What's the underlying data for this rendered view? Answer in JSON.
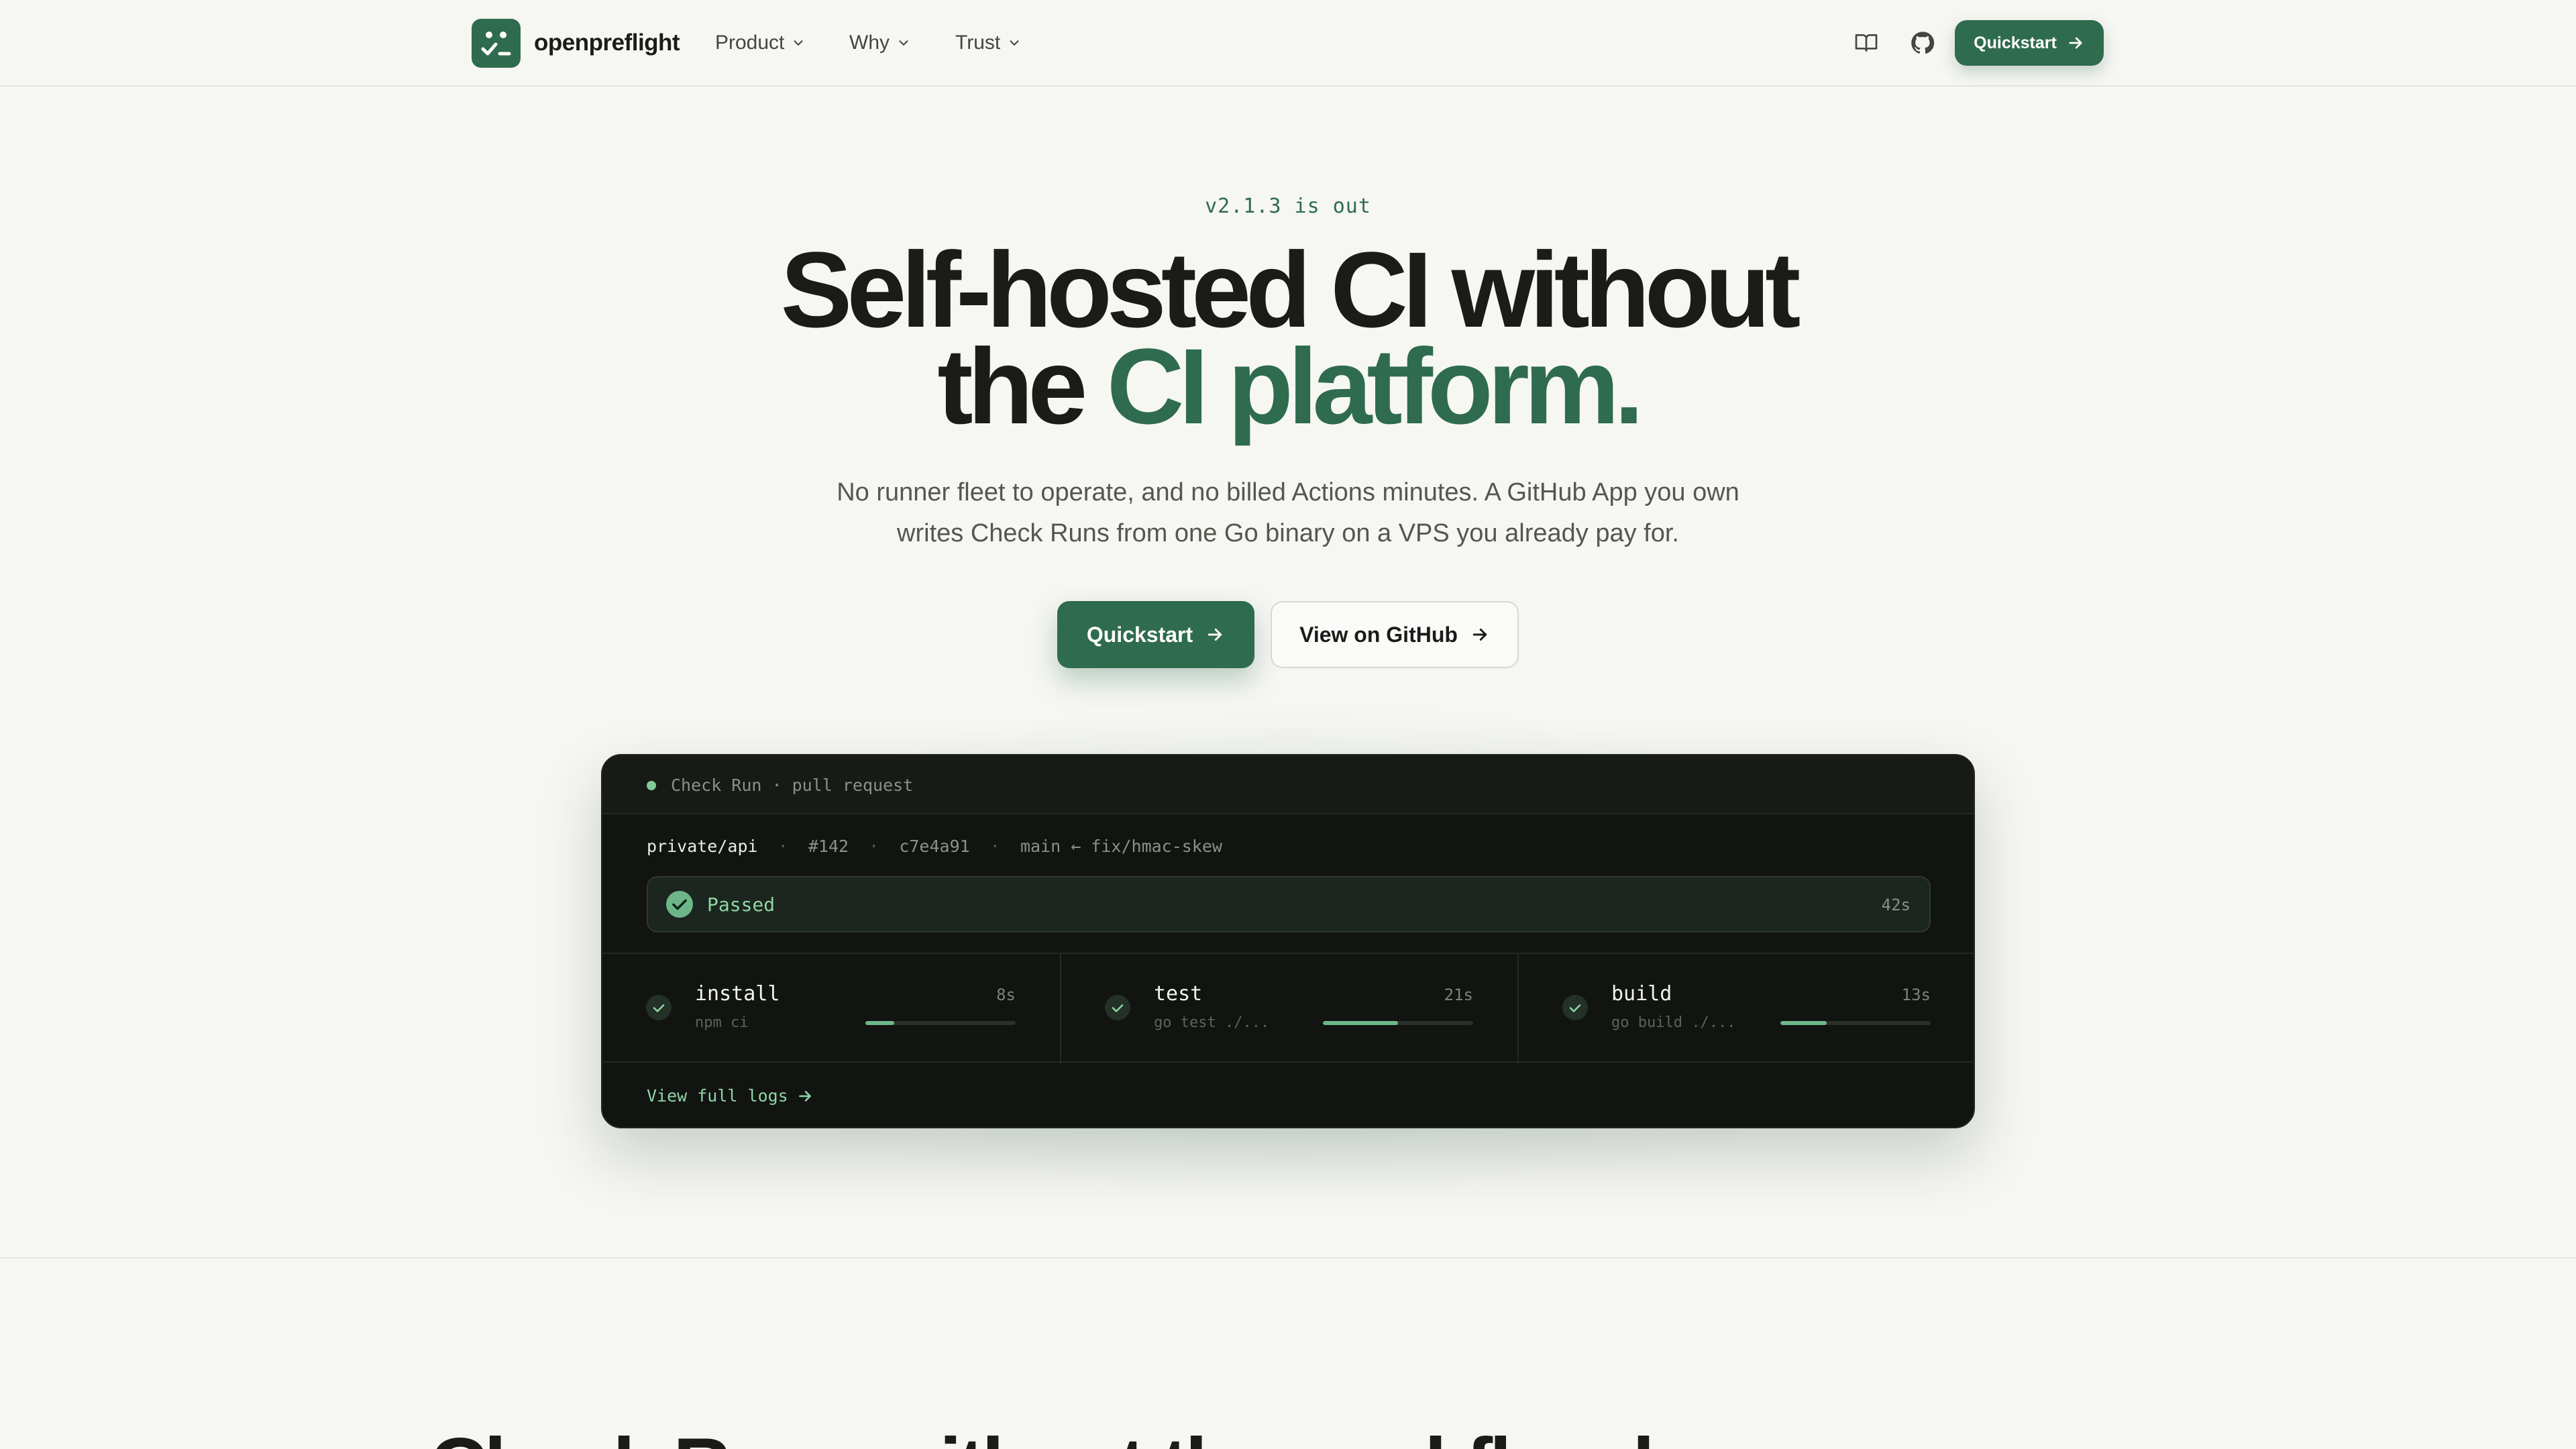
{
  "brand": {
    "name": "openpreflight"
  },
  "nav": {
    "items": [
      {
        "label": "Product"
      },
      {
        "label": "Why"
      },
      {
        "label": "Trust"
      }
    ],
    "icons": {
      "docs": "book-icon",
      "github": "github-icon"
    },
    "cta_label": "Quickstart"
  },
  "hero": {
    "eyebrow": "v2.1.3 is out",
    "headline_line1": "Self-hosted CI without",
    "headline_line2_prefix": "the ",
    "headline_line2_accent": "CI platform.",
    "subtitle": "No runner fleet to operate, and no billed Actions minutes. A GitHub App you own writes Check Runs from one Go binary on a VPS you already pay for.",
    "primary_cta": "Quickstart",
    "secondary_cta": "View on GitHub"
  },
  "check_run": {
    "header_label": "Check Run · pull request",
    "repo": "private/api",
    "pr": "#142",
    "commit": "c7e4a91",
    "branch": "main ← fix/hmac-skew",
    "status": "Passed",
    "duration": "42s",
    "steps": [
      {
        "name": "install",
        "command": "npm ci",
        "duration": "8s",
        "progress": 0.19
      },
      {
        "name": "test",
        "command": "go test ./...",
        "duration": "21s",
        "progress": 0.5
      },
      {
        "name": "build",
        "command": "go build ./...",
        "duration": "13s",
        "progress": 0.31
      }
    ],
    "logs_link": "View full logs"
  },
  "next_section": {
    "title": "Check Runs without the workflow bureaucracy."
  },
  "colors": {
    "accent": "#2f6b4e",
    "background": "#f6f6f3",
    "terminal_bg": "#121412",
    "success": "#8ed6a5"
  }
}
